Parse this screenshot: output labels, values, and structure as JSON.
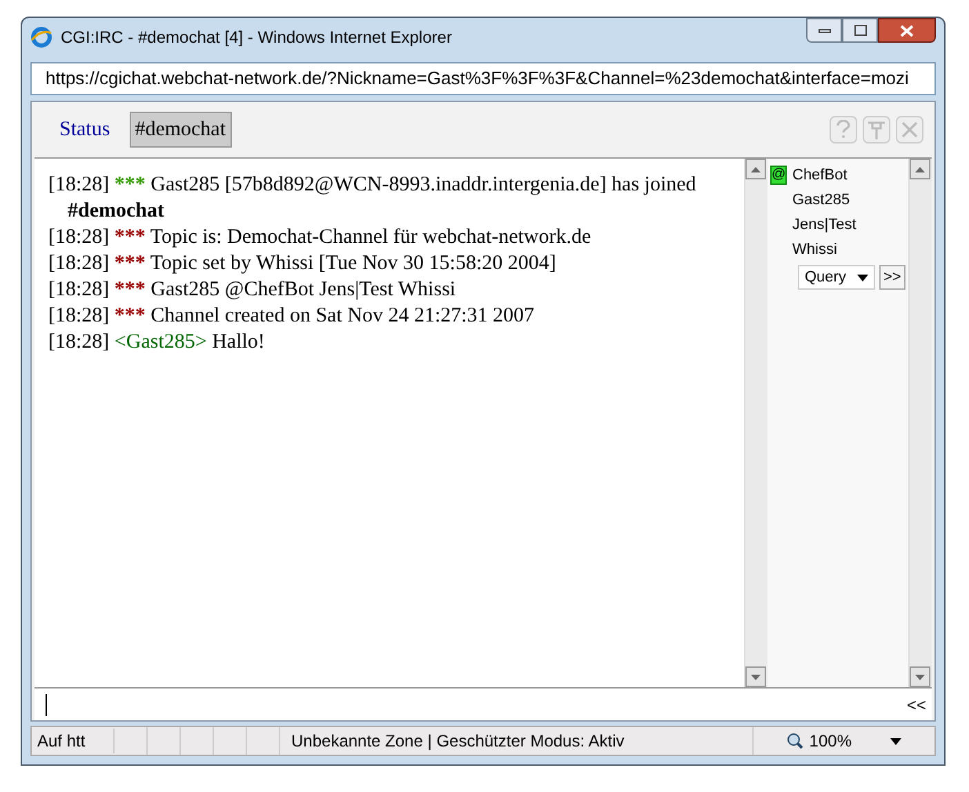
{
  "window": {
    "title": "CGI:IRC - #demochat [4] - Windows Internet Explorer"
  },
  "address_bar": {
    "url": "https://cgichat.webchat-network.de/?Nickname=Gast%3F%3F%3F&Channel=%23demochat&interface=mozi"
  },
  "tabs": [
    {
      "label": "Status",
      "selected": false
    },
    {
      "label": "#demochat",
      "selected": true
    }
  ],
  "messages": [
    {
      "kind": "event",
      "time": "[18:28]",
      "stars": "***",
      "color": "#339900",
      "text": "Gast285 [57b8d892@WCN-8993.inaddr.intergenia.de] has joined **#demochat**"
    },
    {
      "kind": "event",
      "time": "[18:28]",
      "stars": "***",
      "color": "#990000",
      "text": "Topic is: Demochat-Channel für webchat-network.de"
    },
    {
      "kind": "event",
      "time": "[18:28]",
      "stars": "***",
      "color": "#990000",
      "text": "Topic set by Whissi [Tue Nov 30 15:58:20 2004]"
    },
    {
      "kind": "event",
      "time": "[18:28]",
      "stars": "***",
      "color": "#990000",
      "text": "Gast285 @ChefBot Jens|Test Whissi"
    },
    {
      "kind": "event",
      "time": "[18:28]",
      "stars": "***",
      "color": "#990000",
      "text": "Channel created on Sat Nov 24 21:27:31 2007"
    },
    {
      "kind": "chat",
      "time": "[18:28]",
      "nick": "<Gast285>",
      "text": "Hallo!"
    }
  ],
  "nicklist": [
    {
      "name": "ChefBot",
      "op": true,
      "op_mark": "@"
    },
    {
      "name": "Gast285",
      "op": false
    },
    {
      "name": "Jens|Test",
      "op": false
    },
    {
      "name": "Whissi",
      "op": false
    }
  ],
  "nick_action": {
    "value": "Query",
    "go": ">>"
  },
  "input": {
    "toggle": "<<"
  },
  "status_bar": {
    "left": "Auf htt",
    "zone": "Unbekannte Zone | Geschützter Modus: Aktiv",
    "zoom": "100%"
  }
}
